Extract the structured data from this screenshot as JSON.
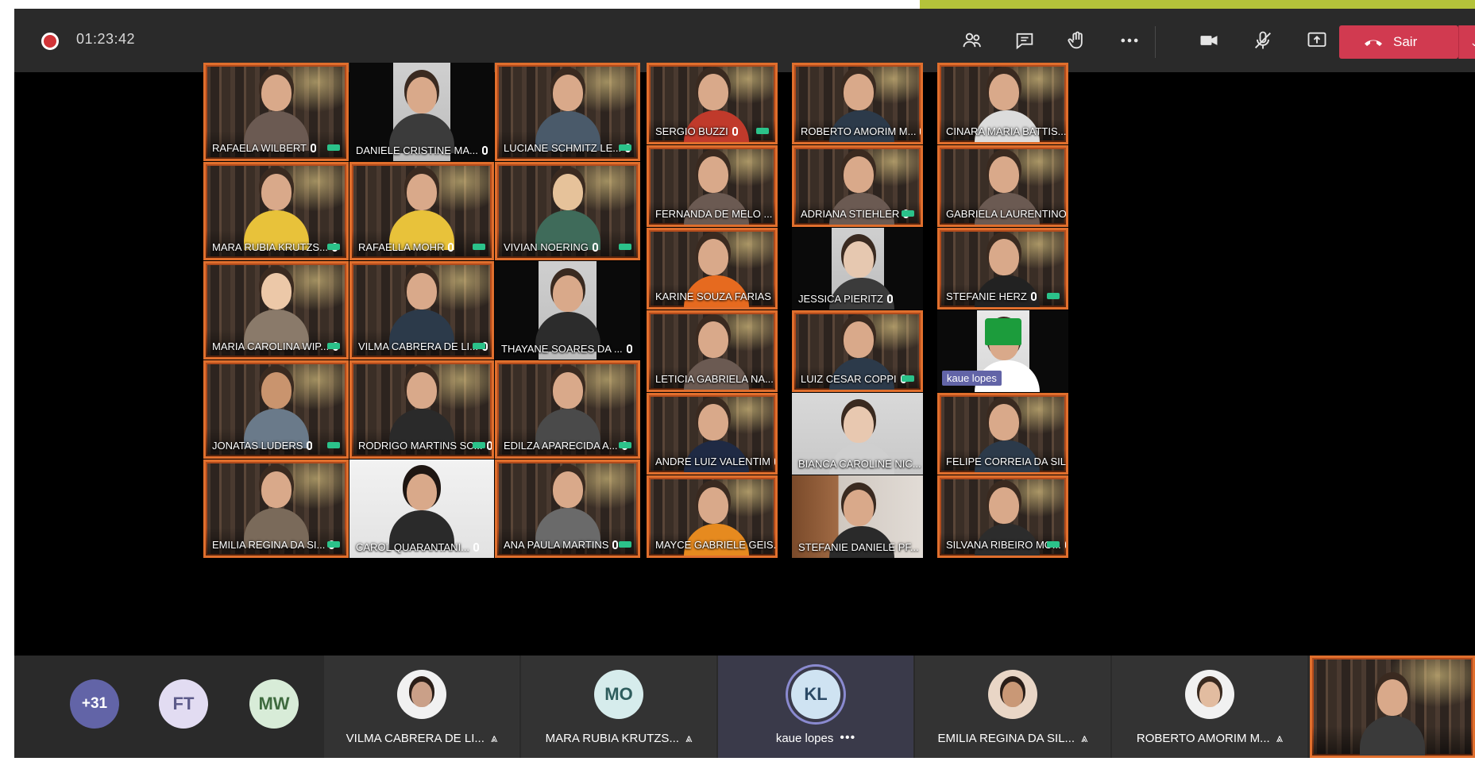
{
  "toolbar": {
    "timer": "01:23:42",
    "leave_label": "Sair",
    "icons": [
      "people-icon",
      "chat-icon",
      "raise-hand-icon",
      "more-icon",
      "camera-icon",
      "mic-off-icon",
      "share-icon"
    ]
  },
  "tiles": [
    {
      "name": "RAFAELA WILBERT"
    },
    {
      "name": "DANIELE CRISTINE MA..."
    },
    {
      "name": "LUCIANE SCHMITZ LE..."
    },
    {
      "name": "SERGIO BUZZI"
    },
    {
      "name": "ROBERTO AMORIM M..."
    },
    {
      "name": "CINARA MARIA BATTIS..."
    },
    {
      "name": "FERNANDA DE MELO ..."
    },
    {
      "name": "ADRIANA STIEHLER"
    },
    {
      "name": "GABRIELA LAURENTINO"
    },
    {
      "name": "MARA RUBIA KRUTZS..."
    },
    {
      "name": "RAFAELLA MOHR"
    },
    {
      "name": "VIVIAN NOERING"
    },
    {
      "name": "KARINE SOUZA FARIAS"
    },
    {
      "name": "JESSICA PIERITZ"
    },
    {
      "name": "STEFANIE HERZ"
    },
    {
      "name": "MARIA CAROLINA WIP..."
    },
    {
      "name": "VILMA CABRERA DE LI..."
    },
    {
      "name": "THAYANE SOARES DA ..."
    },
    {
      "name": "LETICIA GABRIELA NA..."
    },
    {
      "name": "LUIZ CESAR COPPI"
    },
    {
      "name": "kaue lopes"
    },
    {
      "name": "JONATAS LUDERS"
    },
    {
      "name": "RODRIGO MARTINS SC..."
    },
    {
      "name": "EDILZA APARECIDA A..."
    },
    {
      "name": "ANDRE LUIZ VALENTIM"
    },
    {
      "name": "BIANCA CAROLINE NIC..."
    },
    {
      "name": "FELIPE CORREIA DA SIL..."
    },
    {
      "name": "EMILIA REGINA DA SI..."
    },
    {
      "name": "CAROL QUARANTANI..."
    },
    {
      "name": "ANA PAULA MARTINS"
    },
    {
      "name": "MAYCE GABRIELE GEIS..."
    },
    {
      "name": "STEFANIE DANIELE PF..."
    },
    {
      "name": "SILVANA RIBEIRO MO..."
    }
  ],
  "bottom": {
    "overflow_count": "+31",
    "avatars": [
      {
        "initials": "FT",
        "bg": "#e2dcf2",
        "fg": "#5c5a8a"
      },
      {
        "initials": "MW",
        "bg": "#d8ecd8",
        "fg": "#3f6b3f"
      }
    ],
    "panels": [
      {
        "name": "VILMA CABRERA DE LI...",
        "initials": "",
        "bg": "#f1f1f1",
        "fg": "#444",
        "status": "mic-off"
      },
      {
        "name": "MARA RUBIA KRUTZS...",
        "initials": "MO",
        "bg": "#d6ecec",
        "fg": "#2e5d5d",
        "status": "mic-off"
      },
      {
        "name": "kaue lopes",
        "initials": "KL",
        "bg": "#cfe3f2",
        "fg": "#2b4a66",
        "status": "more"
      },
      {
        "name": "EMILIA REGINA DA SIL...",
        "initials": "",
        "bg": "#e9d6c6",
        "fg": "#444",
        "status": "mic-off"
      },
      {
        "name": "ROBERTO AMORIM M...",
        "initials": "",
        "bg": "#f1f1f1",
        "fg": "#444",
        "status": "mic-off"
      }
    ]
  },
  "colors": {
    "toolbar_bg": "#2a2a2a",
    "leave_red": "#d13a50",
    "tile_border": "#e06f2d",
    "accent_bar": "#b4c33a",
    "presence_green": "#2bc28a"
  }
}
